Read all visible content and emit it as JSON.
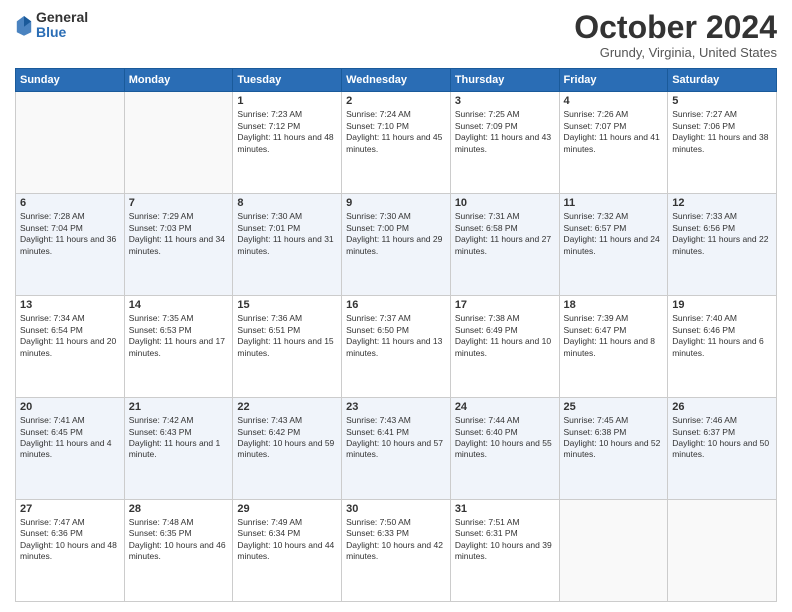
{
  "logo": {
    "general": "General",
    "blue": "Blue"
  },
  "title": "October 2024",
  "location": "Grundy, Virginia, United States",
  "days_header": [
    "Sunday",
    "Monday",
    "Tuesday",
    "Wednesday",
    "Thursday",
    "Friday",
    "Saturday"
  ],
  "weeks": [
    [
      {
        "day": "",
        "sunrise": "",
        "sunset": "",
        "daylight": ""
      },
      {
        "day": "",
        "sunrise": "",
        "sunset": "",
        "daylight": ""
      },
      {
        "day": "1",
        "sunrise": "Sunrise: 7:23 AM",
        "sunset": "Sunset: 7:12 PM",
        "daylight": "Daylight: 11 hours and 48 minutes."
      },
      {
        "day": "2",
        "sunrise": "Sunrise: 7:24 AM",
        "sunset": "Sunset: 7:10 PM",
        "daylight": "Daylight: 11 hours and 45 minutes."
      },
      {
        "day": "3",
        "sunrise": "Sunrise: 7:25 AM",
        "sunset": "Sunset: 7:09 PM",
        "daylight": "Daylight: 11 hours and 43 minutes."
      },
      {
        "day": "4",
        "sunrise": "Sunrise: 7:26 AM",
        "sunset": "Sunset: 7:07 PM",
        "daylight": "Daylight: 11 hours and 41 minutes."
      },
      {
        "day": "5",
        "sunrise": "Sunrise: 7:27 AM",
        "sunset": "Sunset: 7:06 PM",
        "daylight": "Daylight: 11 hours and 38 minutes."
      }
    ],
    [
      {
        "day": "6",
        "sunrise": "Sunrise: 7:28 AM",
        "sunset": "Sunset: 7:04 PM",
        "daylight": "Daylight: 11 hours and 36 minutes."
      },
      {
        "day": "7",
        "sunrise": "Sunrise: 7:29 AM",
        "sunset": "Sunset: 7:03 PM",
        "daylight": "Daylight: 11 hours and 34 minutes."
      },
      {
        "day": "8",
        "sunrise": "Sunrise: 7:30 AM",
        "sunset": "Sunset: 7:01 PM",
        "daylight": "Daylight: 11 hours and 31 minutes."
      },
      {
        "day": "9",
        "sunrise": "Sunrise: 7:30 AM",
        "sunset": "Sunset: 7:00 PM",
        "daylight": "Daylight: 11 hours and 29 minutes."
      },
      {
        "day": "10",
        "sunrise": "Sunrise: 7:31 AM",
        "sunset": "Sunset: 6:58 PM",
        "daylight": "Daylight: 11 hours and 27 minutes."
      },
      {
        "day": "11",
        "sunrise": "Sunrise: 7:32 AM",
        "sunset": "Sunset: 6:57 PM",
        "daylight": "Daylight: 11 hours and 24 minutes."
      },
      {
        "day": "12",
        "sunrise": "Sunrise: 7:33 AM",
        "sunset": "Sunset: 6:56 PM",
        "daylight": "Daylight: 11 hours and 22 minutes."
      }
    ],
    [
      {
        "day": "13",
        "sunrise": "Sunrise: 7:34 AM",
        "sunset": "Sunset: 6:54 PM",
        "daylight": "Daylight: 11 hours and 20 minutes."
      },
      {
        "day": "14",
        "sunrise": "Sunrise: 7:35 AM",
        "sunset": "Sunset: 6:53 PM",
        "daylight": "Daylight: 11 hours and 17 minutes."
      },
      {
        "day": "15",
        "sunrise": "Sunrise: 7:36 AM",
        "sunset": "Sunset: 6:51 PM",
        "daylight": "Daylight: 11 hours and 15 minutes."
      },
      {
        "day": "16",
        "sunrise": "Sunrise: 7:37 AM",
        "sunset": "Sunset: 6:50 PM",
        "daylight": "Daylight: 11 hours and 13 minutes."
      },
      {
        "day": "17",
        "sunrise": "Sunrise: 7:38 AM",
        "sunset": "Sunset: 6:49 PM",
        "daylight": "Daylight: 11 hours and 10 minutes."
      },
      {
        "day": "18",
        "sunrise": "Sunrise: 7:39 AM",
        "sunset": "Sunset: 6:47 PM",
        "daylight": "Daylight: 11 hours and 8 minutes."
      },
      {
        "day": "19",
        "sunrise": "Sunrise: 7:40 AM",
        "sunset": "Sunset: 6:46 PM",
        "daylight": "Daylight: 11 hours and 6 minutes."
      }
    ],
    [
      {
        "day": "20",
        "sunrise": "Sunrise: 7:41 AM",
        "sunset": "Sunset: 6:45 PM",
        "daylight": "Daylight: 11 hours and 4 minutes."
      },
      {
        "day": "21",
        "sunrise": "Sunrise: 7:42 AM",
        "sunset": "Sunset: 6:43 PM",
        "daylight": "Daylight: 11 hours and 1 minute."
      },
      {
        "day": "22",
        "sunrise": "Sunrise: 7:43 AM",
        "sunset": "Sunset: 6:42 PM",
        "daylight": "Daylight: 10 hours and 59 minutes."
      },
      {
        "day": "23",
        "sunrise": "Sunrise: 7:43 AM",
        "sunset": "Sunset: 6:41 PM",
        "daylight": "Daylight: 10 hours and 57 minutes."
      },
      {
        "day": "24",
        "sunrise": "Sunrise: 7:44 AM",
        "sunset": "Sunset: 6:40 PM",
        "daylight": "Daylight: 10 hours and 55 minutes."
      },
      {
        "day": "25",
        "sunrise": "Sunrise: 7:45 AM",
        "sunset": "Sunset: 6:38 PM",
        "daylight": "Daylight: 10 hours and 52 minutes."
      },
      {
        "day": "26",
        "sunrise": "Sunrise: 7:46 AM",
        "sunset": "Sunset: 6:37 PM",
        "daylight": "Daylight: 10 hours and 50 minutes."
      }
    ],
    [
      {
        "day": "27",
        "sunrise": "Sunrise: 7:47 AM",
        "sunset": "Sunset: 6:36 PM",
        "daylight": "Daylight: 10 hours and 48 minutes."
      },
      {
        "day": "28",
        "sunrise": "Sunrise: 7:48 AM",
        "sunset": "Sunset: 6:35 PM",
        "daylight": "Daylight: 10 hours and 46 minutes."
      },
      {
        "day": "29",
        "sunrise": "Sunrise: 7:49 AM",
        "sunset": "Sunset: 6:34 PM",
        "daylight": "Daylight: 10 hours and 44 minutes."
      },
      {
        "day": "30",
        "sunrise": "Sunrise: 7:50 AM",
        "sunset": "Sunset: 6:33 PM",
        "daylight": "Daylight: 10 hours and 42 minutes."
      },
      {
        "day": "31",
        "sunrise": "Sunrise: 7:51 AM",
        "sunset": "Sunset: 6:31 PM",
        "daylight": "Daylight: 10 hours and 39 minutes."
      },
      {
        "day": "",
        "sunrise": "",
        "sunset": "",
        "daylight": ""
      },
      {
        "day": "",
        "sunrise": "",
        "sunset": "",
        "daylight": ""
      }
    ]
  ]
}
